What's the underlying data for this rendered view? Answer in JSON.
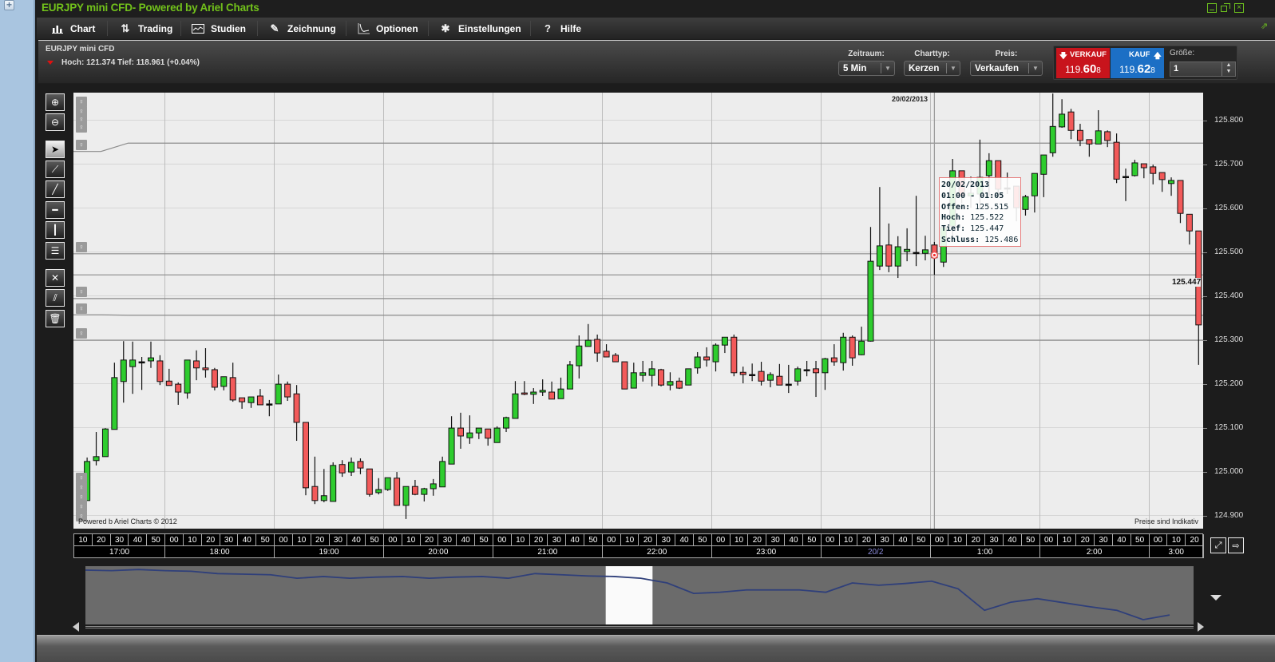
{
  "window": {
    "title": "EURJPY mini  CFD- Powered by Ariel Charts",
    "accent_color": "#72c21b",
    "controls": [
      "minimize-icon",
      "restore-icon",
      "close-icon",
      "popout-icon"
    ]
  },
  "menu": [
    {
      "label": "Chart",
      "icon": "bar-chart-icon"
    },
    {
      "label": "Trading",
      "icon": "trade-arrows-icon"
    },
    {
      "label": "Studien",
      "icon": "studies-icon"
    },
    {
      "label": "Zeichnung",
      "icon": "pencil-icon"
    },
    {
      "label": "Optionen",
      "icon": "options-curve-icon"
    },
    {
      "label": "Einstellungen",
      "icon": "tools-icon"
    },
    {
      "label": "Hilfe",
      "icon": "help-icon"
    }
  ],
  "instrument": {
    "name": "EURJPY mini  CFD",
    "stats": "Hoch: 121.374 Tief: 118.961 (+0.04%)",
    "direction": "down"
  },
  "controls": {
    "zeitraum": {
      "label": "Zeitraum:",
      "value": "5 Min"
    },
    "charttyp": {
      "label": "Charttyp:",
      "value": "Kerzen"
    },
    "preis": {
      "label": "Preis:",
      "value": "Verkaufen"
    }
  },
  "trade": {
    "sell": {
      "label": "VERKAUF",
      "price_prefix": "119.",
      "price_big": "60",
      "price_suffix": "8",
      "color": "#c8141c"
    },
    "buy": {
      "label": "KAUF",
      "price_prefix": "119.",
      "price_big": "62",
      "price_suffix": "8",
      "color": "#1c6fc5"
    },
    "size": {
      "label": "Größe:",
      "value": "1"
    }
  },
  "toolbar": [
    "zoom-in",
    "zoom-out",
    "pointer",
    "line-segment",
    "trend-line",
    "horizontal-line",
    "vertical-line",
    "fibonacci-lines",
    "crosshair-tool",
    "parallel-lines",
    "delete"
  ],
  "chart_data": {
    "type": "candlestick",
    "interval": "5 Min",
    "xlim": [
      "17:10",
      "03:30"
    ],
    "ylim": [
      124.869,
      125.862
    ],
    "grid": true,
    "up_color": "#2ecc2e",
    "down_color": "#f25a5a",
    "price_labels": [
      "125.800",
      "125.700",
      "125.600",
      "125.500",
      "125.400",
      "125.300",
      "125.200",
      "125.100",
      "125.000",
      "124.900"
    ],
    "candles_columns": [
      "time",
      "open",
      "high",
      "low",
      "close"
    ],
    "candles": [
      [
        "17:15",
        124.933,
        125.031,
        124.933,
        125.022
      ],
      [
        "17:20",
        125.024,
        125.089,
        125.013,
        125.033
      ],
      [
        "17:25",
        125.033,
        125.098,
        125.033,
        125.096
      ],
      [
        "17:30",
        125.095,
        125.247,
        125.095,
        125.213
      ],
      [
        "17:35",
        125.204,
        125.296,
        125.156,
        125.253
      ],
      [
        "17:40",
        125.238,
        125.295,
        125.176,
        125.253
      ],
      [
        "17:45",
        125.249,
        125.26,
        125.185,
        125.249
      ],
      [
        "17:50",
        125.251,
        125.295,
        125.235,
        125.258
      ],
      [
        "17:55",
        125.251,
        125.264,
        125.196,
        125.204
      ],
      [
        "18:00",
        125.205,
        125.233,
        125.195,
        125.195
      ],
      [
        "18:05",
        125.198,
        125.202,
        125.151,
        125.18
      ],
      [
        "18:10",
        125.178,
        125.253,
        125.165,
        125.253
      ],
      [
        "18:15",
        125.251,
        125.275,
        125.207,
        125.235
      ],
      [
        "18:20",
        125.235,
        125.28,
        125.213,
        125.231
      ],
      [
        "18:25",
        125.231,
        125.235,
        125.184,
        125.191
      ],
      [
        "18:30",
        125.193,
        125.215,
        125.184,
        125.215
      ],
      [
        "18:35",
        125.213,
        125.247,
        125.158,
        125.162
      ],
      [
        "18:40",
        125.167,
        125.167,
        125.142,
        125.158
      ],
      [
        "18:45",
        125.156,
        125.169,
        125.144,
        125.169
      ],
      [
        "18:50",
        125.171,
        125.187,
        125.151,
        125.151
      ],
      [
        "18:55",
        125.153,
        125.162,
        125.125,
        125.153
      ],
      [
        "19:00",
        125.153,
        125.22,
        125.153,
        125.198
      ],
      [
        "19:05",
        125.198,
        125.204,
        125.16,
        125.169
      ],
      [
        "19:10",
        125.176,
        125.196,
        125.069,
        125.111
      ],
      [
        "19:15",
        125.111,
        125.111,
        124.945,
        124.962
      ],
      [
        "19:20",
        124.965,
        125.033,
        124.925,
        124.933
      ],
      [
        "19:25",
        124.933,
        125.005,
        124.929,
        124.944
      ],
      [
        "19:30",
        124.931,
        125.02,
        124.931,
        125.013
      ],
      [
        "19:35",
        125.015,
        125.025,
        124.987,
        124.996
      ],
      [
        "19:40",
        124.998,
        125.031,
        124.989,
        125.02
      ],
      [
        "19:45",
        125.022,
        125.029,
        124.993,
        125.007
      ],
      [
        "19:50",
        125.005,
        125.005,
        124.942,
        124.947
      ],
      [
        "19:55",
        124.951,
        124.984,
        124.947,
        124.958
      ],
      [
        "20:00",
        124.958,
        124.985,
        124.955,
        124.985
      ],
      [
        "20:05",
        124.984,
        124.998,
        124.922,
        124.922
      ],
      [
        "20:10",
        124.922,
        124.965,
        124.891,
        124.965
      ],
      [
        "20:15",
        124.965,
        124.98,
        124.945,
        124.947
      ],
      [
        "20:20",
        124.947,
        124.962,
        124.931,
        124.96
      ],
      [
        "20:25",
        124.96,
        124.982,
        124.944,
        124.971
      ],
      [
        "20:30",
        124.964,
        125.033,
        124.964,
        125.022
      ],
      [
        "20:35",
        125.016,
        125.125,
        125.016,
        125.098
      ],
      [
        "20:40",
        125.098,
        125.133,
        125.051,
        125.08
      ],
      [
        "20:45",
        125.076,
        125.127,
        125.062,
        125.087
      ],
      [
        "20:50",
        125.087,
        125.098,
        125.073,
        125.098
      ],
      [
        "20:55",
        125.096,
        125.096,
        125.058,
        125.075
      ],
      [
        "21:00",
        125.065,
        125.102,
        125.065,
        125.098
      ],
      [
        "21:05",
        125.098,
        125.124,
        125.089,
        125.122
      ],
      [
        "21:10",
        125.12,
        125.205,
        125.12,
        125.176
      ],
      [
        "21:15",
        125.178,
        125.205,
        125.173,
        125.175
      ],
      [
        "21:20",
        125.175,
        125.189,
        125.153,
        125.18
      ],
      [
        "21:25",
        125.18,
        125.209,
        125.171,
        125.184
      ],
      [
        "21:30",
        125.18,
        125.204,
        125.164,
        125.164
      ],
      [
        "21:35",
        125.165,
        125.213,
        125.165,
        125.187
      ],
      [
        "21:40",
        125.187,
        125.251,
        125.187,
        125.242
      ],
      [
        "21:45",
        125.24,
        125.309,
        125.211,
        125.285
      ],
      [
        "21:50",
        125.284,
        125.335,
        125.284,
        125.298
      ],
      [
        "21:55",
        125.3,
        125.311,
        125.249,
        125.269
      ],
      [
        "22:00",
        125.273,
        125.289,
        125.26,
        125.26
      ],
      [
        "22:05",
        125.264,
        125.269,
        125.249,
        125.249
      ],
      [
        "22:10",
        125.249,
        125.249,
        125.187,
        125.187
      ],
      [
        "22:15",
        125.189,
        125.247,
        125.189,
        125.224
      ],
      [
        "22:20",
        125.218,
        125.251,
        125.204,
        125.224
      ],
      [
        "22:25",
        125.218,
        125.251,
        125.193,
        125.233
      ],
      [
        "22:30",
        125.231,
        125.233,
        125.193,
        125.196
      ],
      [
        "22:35",
        125.196,
        125.225,
        125.184,
        125.204
      ],
      [
        "22:40",
        125.205,
        125.213,
        125.187,
        125.189
      ],
      [
        "22:45",
        125.196,
        125.233,
        125.196,
        125.233
      ],
      [
        "22:50",
        125.235,
        125.271,
        125.222,
        125.26
      ],
      [
        "22:55",
        125.26,
        125.282,
        125.238,
        125.253
      ],
      [
        "23:00",
        125.249,
        125.291,
        125.227,
        125.287
      ],
      [
        "23:05",
        125.287,
        125.305,
        125.269,
        125.305
      ],
      [
        "23:10",
        125.305,
        125.311,
        125.216,
        125.224
      ],
      [
        "23:15",
        125.225,
        125.238,
        125.2,
        125.22
      ],
      [
        "23:20",
        125.22,
        125.245,
        125.205,
        125.22
      ],
      [
        "23:25",
        125.227,
        125.249,
        125.195,
        125.205
      ],
      [
        "23:30",
        125.207,
        125.225,
        125.191,
        125.22
      ],
      [
        "23:35",
        125.216,
        125.244,
        125.196,
        125.196
      ],
      [
        "23:40",
        125.198,
        125.242,
        125.178,
        125.198
      ],
      [
        "23:45",
        125.205,
        125.238,
        125.195,
        125.233
      ],
      [
        "23:50",
        125.231,
        125.251,
        125.216,
        125.231
      ],
      [
        "23:55",
        125.233,
        125.251,
        125.169,
        125.224
      ],
      [
        "00:00",
        125.224,
        125.258,
        125.185,
        125.256
      ],
      [
        "00:05",
        125.258,
        125.289,
        125.24,
        125.249
      ],
      [
        "00:10",
        125.247,
        125.315,
        125.229,
        125.305
      ],
      [
        "00:15",
        125.305,
        125.309,
        125.24,
        125.258
      ],
      [
        "00:20",
        125.265,
        125.329,
        125.264,
        125.296
      ],
      [
        "00:25",
        125.296,
        125.556,
        125.295,
        125.478
      ],
      [
        "00:30",
        125.467,
        125.647,
        125.458,
        125.513
      ],
      [
        "00:35",
        125.515,
        125.564,
        125.453,
        125.467
      ],
      [
        "00:40",
        125.467,
        125.535,
        125.44,
        125.511
      ],
      [
        "00:45",
        125.5,
        125.553,
        125.478,
        125.505
      ],
      [
        "00:50",
        125.498,
        125.627,
        125.467,
        125.498
      ],
      [
        "00:55",
        125.496,
        125.536,
        125.48,
        125.504
      ],
      [
        "01:00",
        125.515,
        125.522,
        125.447,
        125.486
      ],
      [
        "01:05",
        125.476,
        125.56,
        125.465,
        125.555
      ],
      [
        "01:10",
        125.558,
        125.711,
        125.53,
        125.684
      ],
      [
        "01:15",
        125.684,
        125.684,
        125.61,
        125.627
      ],
      [
        "01:20",
        125.627,
        125.671,
        125.6,
        125.633
      ],
      [
        "01:25",
        125.631,
        125.755,
        125.598,
        125.669
      ],
      [
        "01:30",
        125.673,
        125.724,
        125.627,
        125.707
      ],
      [
        "01:35",
        125.707,
        125.707,
        125.627,
        125.642
      ],
      [
        "01:40",
        125.645,
        125.68,
        125.631,
        125.645
      ],
      [
        "01:45",
        125.649,
        125.649,
        125.569,
        125.6
      ],
      [
        "01:50",
        125.596,
        125.629,
        125.582,
        125.625
      ],
      [
        "01:55",
        125.627,
        125.678,
        125.589,
        125.678
      ],
      [
        "02:00",
        125.676,
        125.72,
        125.624,
        125.72
      ],
      [
        "02:05",
        125.725,
        125.86,
        125.716,
        125.785
      ],
      [
        "02:10",
        125.784,
        125.847,
        125.782,
        125.813
      ],
      [
        "02:15",
        125.818,
        125.825,
        125.756,
        125.776
      ],
      [
        "02:20",
        125.776,
        125.791,
        125.74,
        125.753
      ],
      [
        "02:25",
        125.755,
        125.755,
        125.716,
        125.745
      ],
      [
        "02:30",
        125.745,
        125.822,
        125.745,
        125.775
      ],
      [
        "02:35",
        125.773,
        125.776,
        125.738,
        125.753
      ],
      [
        "02:40",
        125.749,
        125.769,
        125.656,
        125.665
      ],
      [
        "02:45",
        125.671,
        125.689,
        125.615,
        125.671
      ],
      [
        "02:50",
        125.673,
        125.709,
        125.671,
        125.702
      ],
      [
        "02:55",
        125.7,
        125.7,
        125.667,
        125.691
      ],
      [
        "03:00",
        125.693,
        125.698,
        125.653,
        125.678
      ],
      [
        "03:05",
        125.68,
        125.68,
        125.636,
        125.664
      ],
      [
        "03:10",
        125.655,
        125.669,
        125.627,
        125.662
      ],
      [
        "03:15",
        125.662,
        125.662,
        125.565,
        125.587
      ],
      [
        "03:20",
        125.585,
        125.585,
        125.516,
        125.547
      ],
      [
        "03:25",
        125.547,
        125.547,
        125.242,
        125.333
      ]
    ],
    "drawn_lines": [
      {
        "from_price": 125.728,
        "to_price": 125.747,
        "bend_from": "17:25",
        "bend_to": "17:40"
      },
      {
        "price": 125.495
      },
      {
        "price": 125.393
      },
      {
        "from_price": 125.356,
        "to_price": 125.355,
        "bend_from": "17:25",
        "bend_to": "17:40"
      },
      {
        "price": 125.298
      }
    ],
    "crosshair": {
      "time": "01:00",
      "price": 125.447,
      "price_label": "125.447",
      "date_label": "20/02/2013"
    },
    "tooltip": {
      "date": "20/02/2013",
      "range": "01:00 - 01:05",
      "rows": [
        {
          "label": "Offen:",
          "value": "125.515"
        },
        {
          "label": "Hoch:",
          "value": "125.522"
        },
        {
          "label": "Tief:",
          "value": "125.447"
        },
        {
          "label": "Schluss:",
          "value": "125.486"
        }
      ]
    },
    "footer_left": "Powered b Ariel Charts © 2012",
    "footer_right": "Preise sind Indikativ"
  },
  "time_axis": [
    {
      "label": "17:00",
      "minutes": [
        "10",
        "20",
        "30",
        "40",
        "50"
      ]
    },
    {
      "label": "18:00",
      "minutes": [
        "00",
        "10",
        "20",
        "30",
        "40",
        "50"
      ]
    },
    {
      "label": "19:00",
      "minutes": [
        "00",
        "10",
        "20",
        "30",
        "40",
        "50"
      ]
    },
    {
      "label": "20:00",
      "minutes": [
        "00",
        "10",
        "20",
        "30",
        "40",
        "50"
      ]
    },
    {
      "label": "21:00",
      "minutes": [
        "00",
        "10",
        "20",
        "30",
        "40",
        "50"
      ]
    },
    {
      "label": "22:00",
      "minutes": [
        "00",
        "10",
        "20",
        "30",
        "40",
        "50"
      ]
    },
    {
      "label": "23:00",
      "minutes": [
        "00",
        "10",
        "20",
        "30",
        "40",
        "50"
      ]
    },
    {
      "label": "20/2",
      "minutes": [
        "00",
        "10",
        "20",
        "30",
        "40",
        "50"
      ],
      "is_date": true
    },
    {
      "label": "1:00",
      "minutes": [
        "00",
        "10",
        "20",
        "30",
        "40",
        "50"
      ]
    },
    {
      "label": "2:00",
      "minutes": [
        "00",
        "10",
        "20",
        "30",
        "40",
        "50"
      ]
    },
    {
      "label": "3:00",
      "minutes": [
        "00",
        "10",
        "20"
      ]
    }
  ],
  "navigator": {
    "levels_pct": [
      96,
      95,
      97,
      95,
      94,
      90,
      89,
      88,
      82,
      85,
      82,
      84,
      85,
      82,
      84,
      85,
      82,
      90,
      88,
      86,
      85,
      82,
      74,
      56,
      58,
      62,
      62,
      62,
      58,
      74,
      70,
      73,
      77,
      64,
      27,
      41,
      47,
      40,
      33,
      27,
      11,
      19
    ],
    "window_start_pct": 46.9,
    "window_end_pct": 51.2
  }
}
